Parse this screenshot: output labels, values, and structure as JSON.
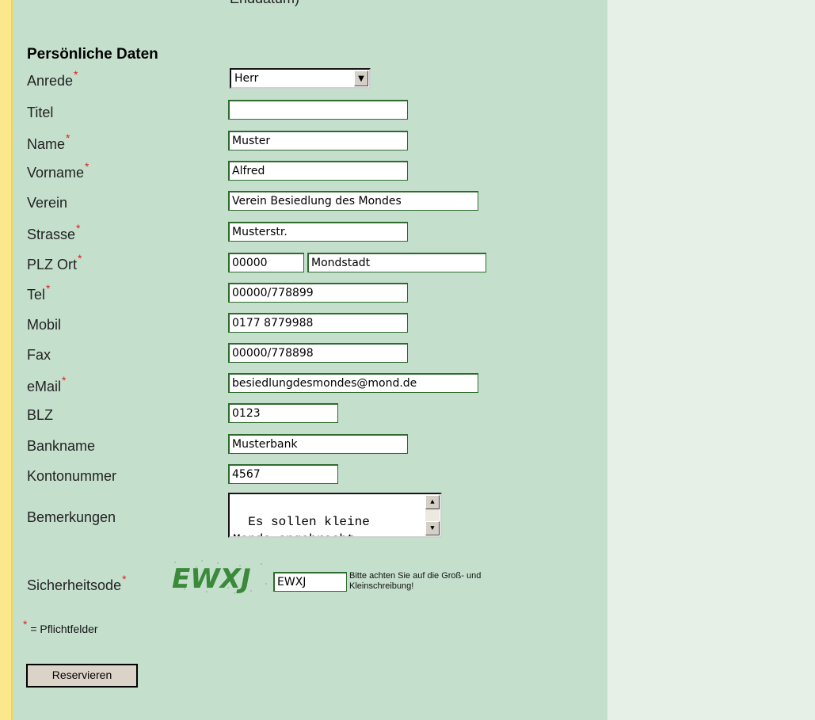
{
  "cut_top_text": "Enddatum)",
  "section_title": "Persönliche Daten",
  "required_marker": "*",
  "fields": {
    "anrede": {
      "label": "Anrede",
      "value": "Herr"
    },
    "titel": {
      "label": "Titel",
      "value": ""
    },
    "name": {
      "label": "Name",
      "value": "Muster"
    },
    "vorname": {
      "label": "Vorname",
      "value": "Alfred"
    },
    "verein": {
      "label": "Verein",
      "value": "Verein Besiedlung des Mondes"
    },
    "strasse": {
      "label": "Strasse",
      "value": "Musterstr."
    },
    "plz_ort": {
      "label": "PLZ Ort",
      "plz": "00000",
      "ort": "Mondstadt"
    },
    "tel": {
      "label": "Tel",
      "value": "00000/778899"
    },
    "mobil": {
      "label": "Mobil",
      "value": "0177 8779988"
    },
    "fax": {
      "label": "Fax",
      "value": "00000/778898"
    },
    "email": {
      "label": "eMail",
      "value": "besiedlungdesmondes@mond.de"
    },
    "blz": {
      "label": "BLZ",
      "value": "0123"
    },
    "bankname": {
      "label": "Bankname",
      "value": "Musterbank"
    },
    "kontonummer": {
      "label": "Kontonummer",
      "value": "4567"
    },
    "bemerkungen": {
      "label": "Bemerkungen",
      "value": "Es sollen kleine\nMonde angebracht"
    }
  },
  "security": {
    "label": "Sicherheitsode",
    "captcha_text": "EWXJ",
    "value": "EWXJ",
    "note_line1": "Bitte achten Sie auf die Groß- und",
    "note_line2": "Kleinschreibung!"
  },
  "legend_text": "= Pflichtfelder",
  "submit_label": "Reservieren",
  "colors": {
    "panel": "#c5dfcd",
    "right_pane": "#e6f0e6",
    "left_strip": "#fbe88c",
    "field_border": "#2f6b2f",
    "required": "#e02020"
  }
}
